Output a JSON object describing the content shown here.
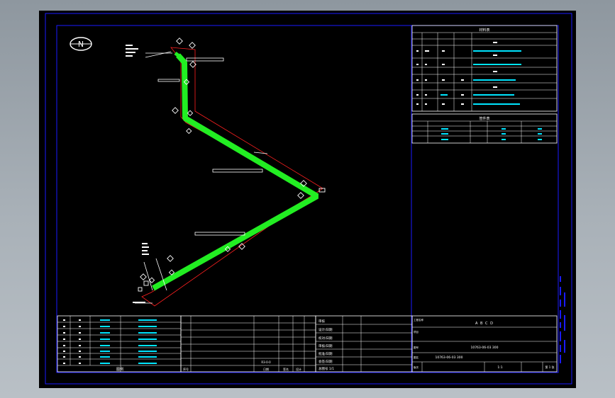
{
  "drawing": {
    "north_label": "N",
    "title_block": {
      "labels": [
        "审核",
        "设计/日期",
        "校对/日期",
        "审核/日期",
        "批准/日期",
        "会签/日期",
        "总图号 1/1"
      ],
      "bottom_labels": [
        "序号",
        "",
        "日期",
        "签名",
        "设计"
      ],
      "drawing_no": "10763-06-03 300",
      "drawing_no_2": "10763-06-03 300",
      "project_name": "A  B  C  D",
      "sheet_text": "第 1 张",
      "scale_text": "1:1",
      "revision_text": "R3-0-0",
      "small_labels": [
        "工程名称",
        "项目",
        "图号",
        "图名",
        "版次"
      ]
    },
    "upper_table": {
      "title": "材料表"
    },
    "lower_table": {
      "title": "管件表"
    },
    "legend_table": {
      "title": "图例"
    }
  },
  "colors": {
    "background": "#000000",
    "frame": "#1a1aff",
    "pipe": "#22ee22",
    "dimension": "#ff2020",
    "text": "#ffffff",
    "cyan_text": "#00e5ff"
  }
}
